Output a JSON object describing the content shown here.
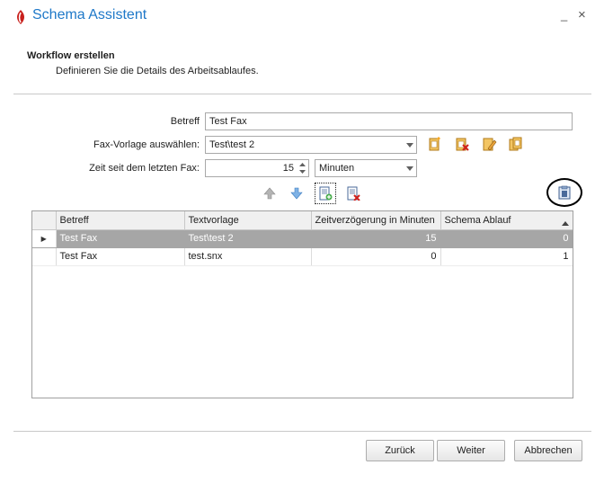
{
  "window": {
    "title": "Schema Assistent",
    "minimize_label": "_",
    "close_label": "×"
  },
  "header": {
    "title": "Workflow erstellen",
    "subtitle": "Definieren Sie die Details des Arbeitsablaufes."
  },
  "form": {
    "betreff_label": "Betreff",
    "betreff_value": "Test Fax",
    "fax_vorlage_label": "Fax-Vorlage auswählen:",
    "fax_vorlage_value": "Test\\test 2",
    "zeit_label": "Zeit seit dem letzten Fax:",
    "zeit_value": "15",
    "zeit_unit": "Minuten"
  },
  "grid": {
    "columns": [
      "Betreff",
      "Textvorlage",
      "Zeitverzögerung in Minuten",
      "Schema Ablauf"
    ],
    "rows": [
      {
        "betreff": "Test Fax",
        "textvorlage": "Test\\test 2",
        "zeitverzoegerung": "15",
        "schema_ablauf": "0",
        "selected": true
      },
      {
        "betreff": "Test Fax",
        "textvorlage": "test.snx",
        "zeitverzoegerung": "0",
        "schema_ablauf": "1",
        "selected": false
      }
    ]
  },
  "footer": {
    "back_label": "Zurück",
    "next_label": "Weiter",
    "cancel_label": "Abbrechen"
  },
  "colors": {
    "accent": "#1e78c8",
    "selected_row": "#a6a6a6"
  },
  "icons": {
    "logo": "app-logo-icon",
    "new_template": "new-template-icon",
    "delete_template": "delete-template-icon",
    "edit_template": "edit-template-icon",
    "copy_template": "copy-template-icon",
    "move_up": "arrow-up-icon",
    "move_down": "arrow-down-icon",
    "add_step": "add-step-icon",
    "remove_step": "remove-step-icon",
    "clipboard": "clipboard-icon"
  }
}
